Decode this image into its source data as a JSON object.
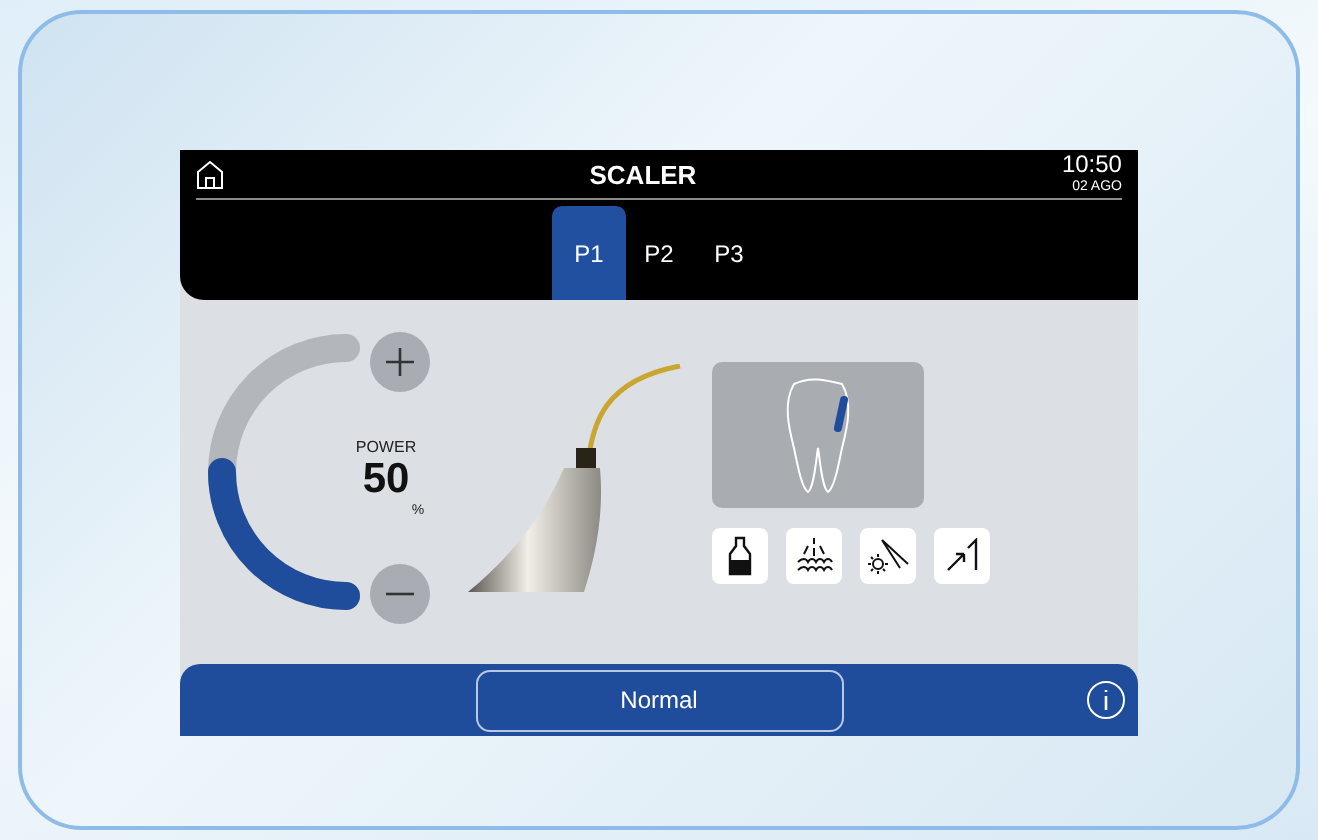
{
  "header": {
    "title": "SCALER",
    "time": "10:50",
    "date": "02 AGO"
  },
  "tabs": [
    {
      "label": "P1",
      "selected": true
    },
    {
      "label": "P2",
      "selected": false
    },
    {
      "label": "P3",
      "selected": false
    }
  ],
  "power": {
    "label": "POWER",
    "value": "50",
    "unit": "%",
    "level": 0.5
  },
  "footer": {
    "mode": "Normal"
  }
}
